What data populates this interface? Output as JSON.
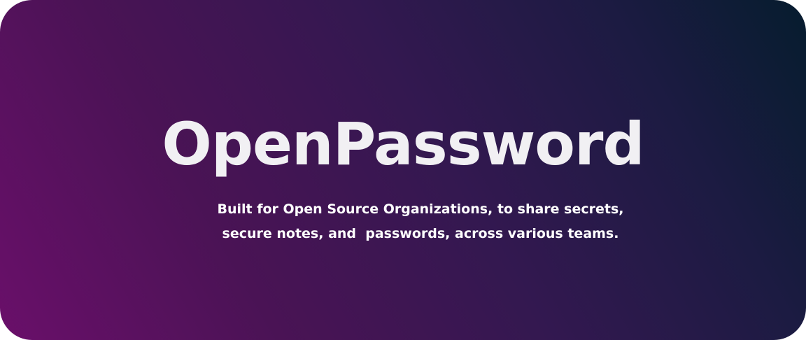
{
  "banner": {
    "title": "OpenPassword",
    "subtitle_lines": [
      "Built for Open Source Organizations, to share secrets,",
      "secure notes, and  passwords, across various teams."
    ],
    "colors": {
      "gradient_start": "#6a0f6a",
      "gradient_end": "#061c2e",
      "title": "#f1f0f3",
      "subtitle": "#ffffff"
    }
  }
}
